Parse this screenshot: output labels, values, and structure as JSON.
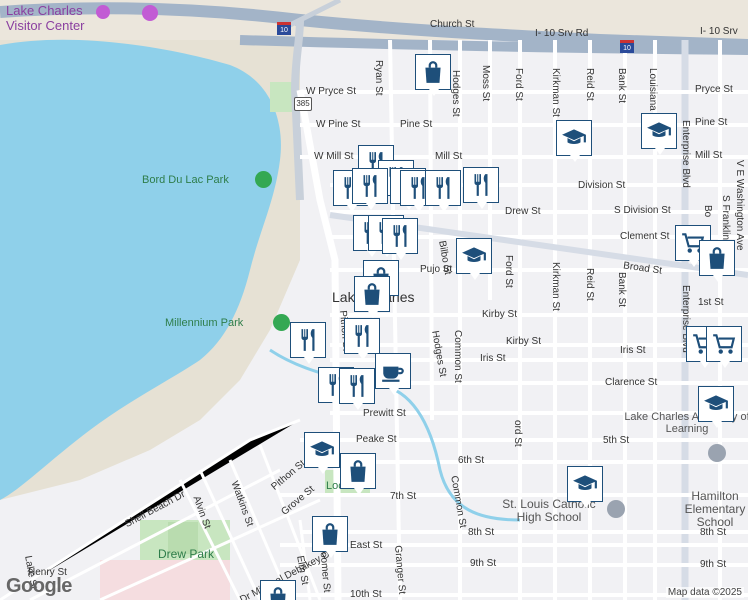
{
  "streets": {
    "church": "Church St",
    "i10_srv": "I- 10 Srv Rd",
    "i10_srv2": "I- 10 Srv",
    "ryan": "Ryan St",
    "hodges": "Hodges St",
    "moss": "Moss St",
    "ford": "Ford St",
    "kirkman": "Kirkman St",
    "reid": "Reid St",
    "bank": "Bank St",
    "louisiana": "Louisiana Ave",
    "w_pryce": "W Pryce St",
    "pryce": "Pryce St",
    "pryce_e": "Pryce St",
    "w_pine": "W Pine St",
    "pine": "Pine St",
    "pine_e": "Pine St",
    "w_mill": "W Mill St",
    "mill": "Mill St",
    "mill_e": "Mill St",
    "division": "Division St",
    "s_division": "S Division St",
    "drew": "Drew St",
    "clement": "Clement St",
    "broad": "Broad St",
    "pujo": "Pujo St",
    "bilbo": "Bilbo St",
    "kirby": "Kirby St",
    "kirby2": "Kirby St",
    "iris": "Iris St",
    "iris2": "Iris St",
    "clarence": "Clarence St",
    "common": "Common St",
    "common2": "Common St",
    "prewitt": "Prewitt St",
    "peake": "Peake St",
    "fifth": "5th St",
    "sixth": "6th St",
    "seventh": "7th St",
    "eighth": "8th St",
    "eighth2": "8th St",
    "ninth": "9th St",
    "ninth2": "9th St",
    "first": "1st St",
    "enterprise": "Enterprise Blvd",
    "enterprise2": "Enterprise Blvd",
    "ve_washington": "V E Washington Ave",
    "s_franklin": "S Franklin",
    "pithon": "Pithon St",
    "pithon2": "Pithon St",
    "grove": "Grove St",
    "shell_beach": "Shell Beach Dr",
    "alvin": "Alvin St",
    "watkins": "Watkins St",
    "mlk": "Dr Michael Debakey Dr",
    "elm": "Elm St",
    "boomer": "Boomer St",
    "granger": "Granger St",
    "east": "East St",
    "tenth": "10th St",
    "henry": "Henry St",
    "lake": "Lake St",
    "bo": "Bo",
    "ford2": "Ford St",
    "hodges2": "Hodges St",
    "reid2": "Reid St",
    "bank2": "Bank St",
    "kirkman2": "Kirkman St",
    "ord": "ord St"
  },
  "places": {
    "visitor_center": "Lake Charles Visitor Center",
    "bord_du_lac": "Bord Du Lac Park",
    "millennium": "Millennium Park",
    "city": "Lake Charles",
    "academy": "Lake Charles Academy of Learning",
    "st_louis": "St. Louis Catholic High School",
    "hamilton": "Hamilton Elementary School",
    "drew_park": "Drew Park",
    "lock_park": "Lock Park"
  },
  "shields": {
    "la385": "385",
    "i10a": "10",
    "i10b": "10"
  },
  "attribution": "Map data ©2025",
  "logo": "Google",
  "colors": {
    "water": "#8fd0ea",
    "pin_border": "#1e4f7a",
    "park": "#c8e6c0",
    "highway": "#a3b4c8"
  }
}
